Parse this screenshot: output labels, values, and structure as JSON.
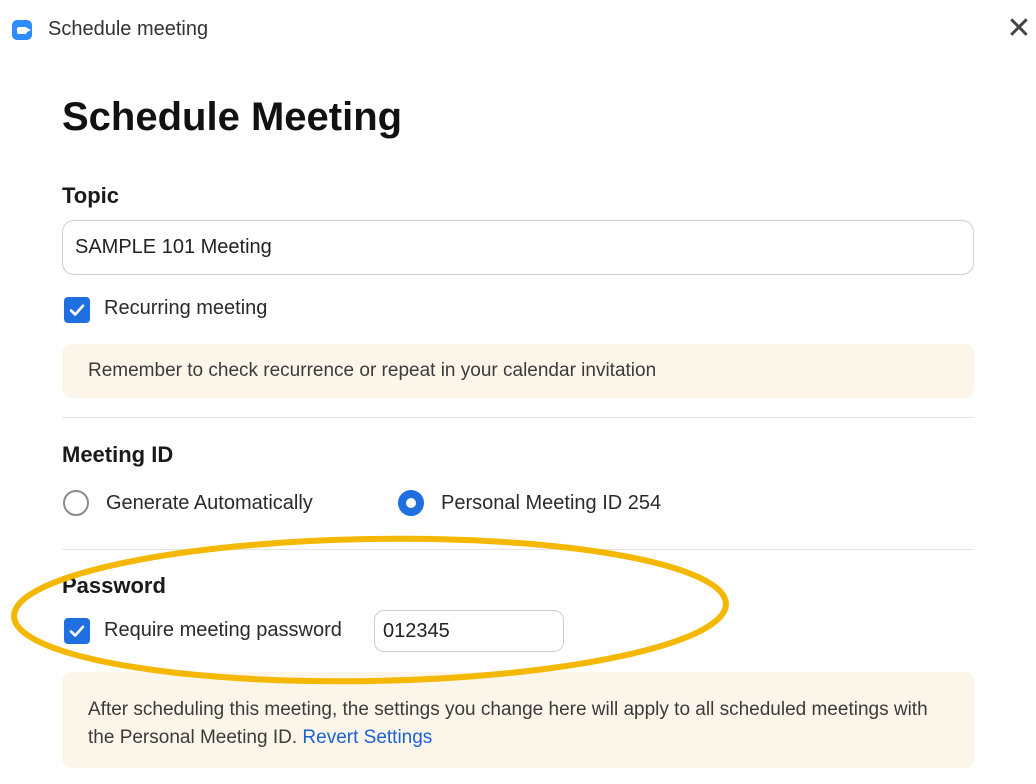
{
  "window": {
    "title": "Schedule meeting",
    "close_symbol": "✕"
  },
  "heading": "Schedule Meeting",
  "topic": {
    "label": "Topic",
    "value": "SAMPLE 101 Meeting"
  },
  "recurring": {
    "label": "Recurring meeting",
    "checked": true,
    "notice": "Remember to check recurrence or repeat in your calendar invitation"
  },
  "meeting_id": {
    "label": "Meeting ID",
    "options": [
      {
        "label": "Generate Automatically",
        "selected": false
      },
      {
        "label": "Personal Meeting ID 254",
        "selected": true
      }
    ]
  },
  "password": {
    "label": "Password",
    "require_label": "Require meeting password",
    "checked": true,
    "value": "012345"
  },
  "footer_notice": {
    "text": "After scheduling this meeting, the settings you change here will apply to all scheduled meetings with the Personal Meeting ID.",
    "link": "Revert Settings"
  },
  "colors": {
    "accent": "#1f6fe0",
    "highlight": "#f5b800",
    "notice_bg": "#fcf5ea"
  }
}
